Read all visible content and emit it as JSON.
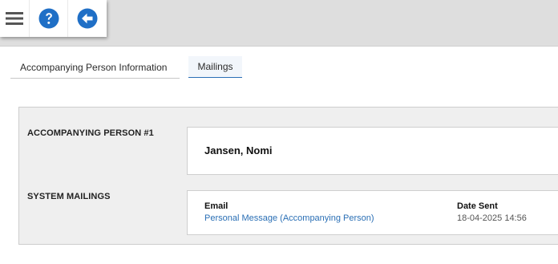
{
  "toolbar": {
    "menu_icon": "hamburger-menu-icon",
    "help_icon": "question-circle-icon",
    "back_icon": "arrow-left-circle-icon",
    "accent_color": "#1f6fc6"
  },
  "tabs": [
    {
      "label": "Accompanying Person Information",
      "active": false
    },
    {
      "label": "Mailings",
      "active": true
    }
  ],
  "person": {
    "section_label": "ACCOMPANYING PERSON #1",
    "name": "Jansen, Nomi"
  },
  "mailings": {
    "section_label": "SYSTEM MAILINGS",
    "columns": {
      "email": "Email",
      "date_sent": "Date Sent"
    },
    "rows": [
      {
        "email": "Personal Message (Accompanying Person)",
        "date_sent": "18-04-2025 14:56"
      }
    ]
  }
}
